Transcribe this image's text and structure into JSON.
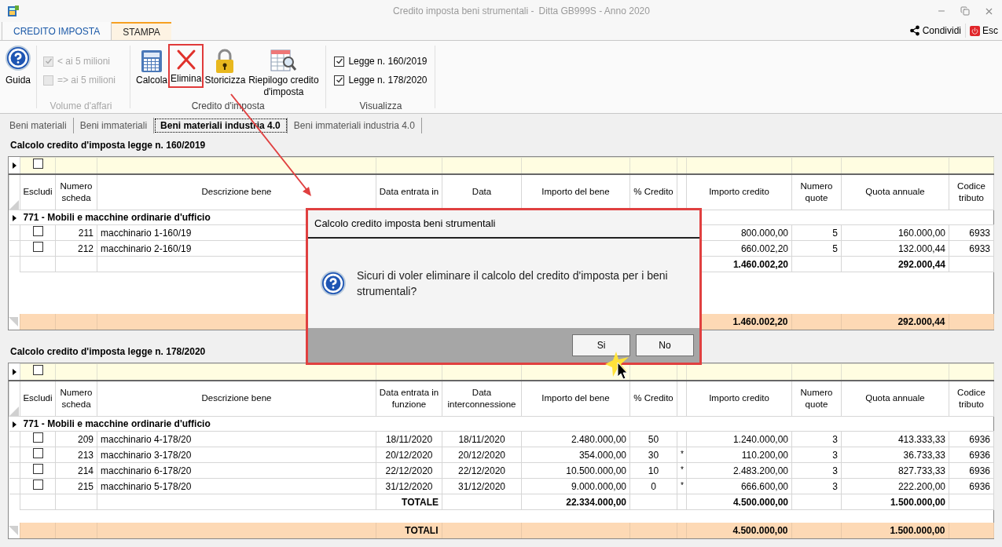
{
  "window": {
    "title": "Credito imposta beni strumentali -",
    "subtitle": "Ditta GB999S - Anno 2020"
  },
  "ribbon_tabs": [
    {
      "label": "CREDITO IMPOSTA",
      "selected": true
    },
    {
      "label": "STAMPA",
      "selected": false
    }
  ],
  "ribbon_actions": [
    {
      "kind": "share",
      "label": "Condividi"
    },
    {
      "kind": "exit",
      "label": "Esc"
    }
  ],
  "help_button": {
    "label": "Guida"
  },
  "volume_group": {
    "label": "Volume d'affari",
    "options": [
      {
        "label": "< ai 5 milioni",
        "checked": true,
        "disabled": true
      },
      {
        "label": "=> ai 5 milioni",
        "checked": false,
        "disabled": true
      }
    ]
  },
  "credit_group": {
    "label": "Credito d'imposta",
    "buttons": [
      {
        "kind": "calculator",
        "label": "Calcola",
        "highlighted": false
      },
      {
        "kind": "delete",
        "label": "Elimina",
        "highlighted": true
      },
      {
        "kind": "lock",
        "label": "Storicizza",
        "highlighted": false
      },
      {
        "kind": "report",
        "label": "Riepilogo credito d'imposta",
        "highlighted": false
      }
    ]
  },
  "view_group": {
    "label": "Visualizza",
    "options": [
      {
        "label": "Legge n. 160/2019",
        "checked": true,
        "disabled": false
      },
      {
        "label": "Legge n. 178/2020",
        "checked": true,
        "disabled": false
      }
    ]
  },
  "sub_tabs": [
    {
      "label": "Beni materiali",
      "selected": false
    },
    {
      "label": "Beni immateriali",
      "selected": false
    },
    {
      "label": "Beni materiali industria 4.0",
      "selected": true
    },
    {
      "label": "Beni immateriali industria 4.0",
      "selected": false
    }
  ],
  "sections": [
    {
      "title": "Calcolo credito d'imposta legge n. 160/2019",
      "filter_checked": false,
      "columns": [
        "Escludi",
        "Numero scheda",
        "Descrizione bene",
        "Data entrata in",
        "Data",
        "Importo del bene",
        "% Credito",
        "Importo credito",
        "Numero quote",
        "Quota annuale",
        "Codice tributo"
      ],
      "group": "771 - Mobili e macchine ordinarie d'ufficio",
      "rows": [
        {
          "excluded": false,
          "cells": {
            "numero": "211",
            "descrizione": "macchinario 1-160/19",
            "importo_credito": "800.000,00",
            "quote": "5",
            "quota_annuale": "160.000,00",
            "codice": "6933"
          }
        },
        {
          "excluded": false,
          "cells": {
            "numero": "212",
            "descrizione": "macchinario 2-160/19",
            "importo_credito": "660.002,20",
            "quote": "5",
            "quota_annuale": "132.000,44",
            "codice": "6933"
          }
        }
      ],
      "total": {
        "importo_credito": "1.460.002,20",
        "quota_annuale": "292.000,44"
      },
      "totals": {
        "importo_credito": "1.460.002,20",
        "quota_annuale": "292.000,44"
      }
    },
    {
      "title": "Calcolo credito d'imposta legge n. 178/2020",
      "filter_checked": false,
      "columns": [
        "Escludi",
        "Numero scheda",
        "Descrizione bene",
        "Data entrata in funzione",
        "Data interconnessione",
        "Importo del bene",
        "% Credito",
        "Importo credito",
        "Numero quote",
        "Quota annuale",
        "Codice tributo"
      ],
      "group": "771 - Mobili e macchine ordinarie d'ufficio",
      "rows": [
        {
          "excluded": false,
          "cells": {
            "numero": "209",
            "descrizione": "macchinario 4-178/20",
            "data_entrata": "18/11/2020",
            "data_interconnessione": "18/11/2020",
            "importo_bene": "2.480.000,00",
            "perc": "50",
            "importo_credito": "1.240.000,00",
            "quote": "3",
            "quota_annuale": "413.333,33",
            "codice": "6936"
          }
        },
        {
          "excluded": false,
          "cells": {
            "numero": "213",
            "descrizione": "macchinario 3-178/20",
            "data_entrata": "20/12/2020",
            "data_interconnessione": "20/12/2020",
            "importo_bene": "354.000,00",
            "perc": "30",
            "flag": "*",
            "importo_credito": "110.200,00",
            "quote": "3",
            "quota_annuale": "36.733,33",
            "codice": "6936"
          }
        },
        {
          "excluded": false,
          "cells": {
            "numero": "214",
            "descrizione": "macchinario 6-178/20",
            "data_entrata": "22/12/2020",
            "data_interconnessione": "22/12/2020",
            "importo_bene": "10.500.000,00",
            "perc": "10",
            "flag": "*",
            "importo_credito": "2.483.200,00",
            "quote": "3",
            "quota_annuale": "827.733,33",
            "codice": "6936"
          }
        },
        {
          "excluded": false,
          "cells": {
            "numero": "215",
            "descrizione": "macchinario 5-178/20",
            "data_entrata": "31/12/2020",
            "data_interconnessione": "31/12/2020",
            "importo_bene": "9.000.000,00",
            "perc": "0",
            "flag": "*",
            "importo_credito": "666.600,00",
            "quote": "3",
            "quota_annuale": "222.200,00",
            "codice": "6936"
          }
        }
      ],
      "total": {
        "data_entrata": "TOTALE",
        "importo_bene": "22.334.000,00",
        "importo_credito": "4.500.000,00",
        "quota_annuale": "1.500.000,00"
      },
      "totals": {
        "data_entrata": "TOTALI",
        "importo_credito": "4.500.000,00",
        "quota_annuale": "1.500.000,00"
      }
    }
  ],
  "dialog": {
    "title": "Calcolo credito imposta beni strumentali",
    "message": "Sicuri di voler eliminare il calcolo del credito d'imposta per i beni strumentali?",
    "buttons": [
      "Si",
      "No"
    ]
  }
}
